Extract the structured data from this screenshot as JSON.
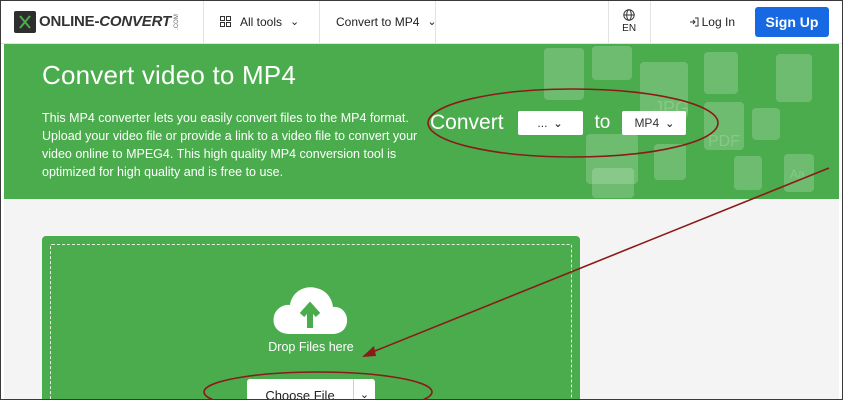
{
  "nav": {
    "logo_main": "ONLINE-",
    "logo_accent": "CONVERT",
    "logo_suffix": ".COM",
    "all_tools": "All tools",
    "convert_menu": "Convert to MP4",
    "lang": "EN",
    "login": "Log In",
    "signup": "Sign Up"
  },
  "hero": {
    "title": "Convert video to MP4",
    "description": "This MP4 converter lets you easily convert files to the MP4 format. Upload your video file or provide a link to a video file to convert your video online to MPEG4. This high quality MP4 conversion tool is optimized for high quality and is free to use.",
    "convert_label": "Convert",
    "from_value": "...",
    "to_label": "to",
    "to_value": "MP4",
    "deco_labels": [
      "JPG",
      "PDF",
      "Aa"
    ]
  },
  "upload": {
    "drop_text": "Drop Files here",
    "choose_label": "Choose File"
  },
  "colors": {
    "green": "#4bac4d",
    "signup_blue": "#1769e3",
    "annotation_red": "#8b1a1a"
  },
  "icons": [
    "grid-icon",
    "chevron-down-icon",
    "globe-icon",
    "login-icon",
    "cloud-upload-icon"
  ]
}
